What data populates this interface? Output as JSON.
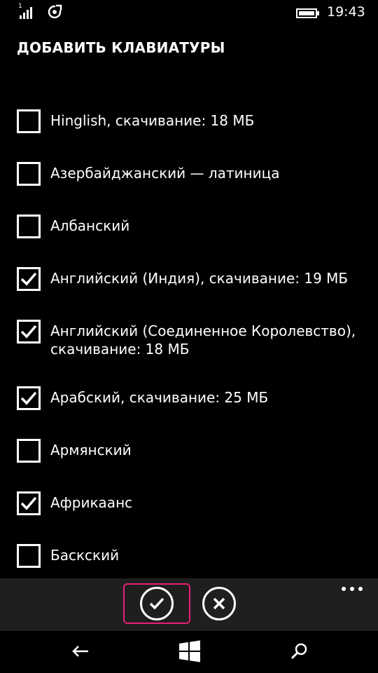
{
  "status": {
    "sim_label": "1",
    "time": "19:43"
  },
  "page": {
    "title": "ДОБАВИТЬ КЛАВИАТУРЫ"
  },
  "keyboards": [
    {
      "label": "Hinglish, скачивание: 18 МБ",
      "checked": false
    },
    {
      "label": "Азербайджанский — латиница",
      "checked": false
    },
    {
      "label": "Албанский",
      "checked": false
    },
    {
      "label": "Английский (Индия), скачивание: 19 МБ",
      "checked": true
    },
    {
      "label": "Английский (Соединенное Королевство), скачивание: 18 МБ",
      "checked": true
    },
    {
      "label": "Арабский, скачивание: 25 МБ",
      "checked": true
    },
    {
      "label": "Армянский",
      "checked": false
    },
    {
      "label": "Африкаанс",
      "checked": true
    },
    {
      "label": "Баскский",
      "checked": false
    }
  ],
  "appbar": {
    "accent_highlight": "#e8207a",
    "background": "#1f1f1f"
  },
  "icons": {
    "signal": "signal-strength-icon",
    "wifi": "wifi-icon",
    "battery": "battery-icon",
    "accept": "checkmark-icon",
    "cancel": "close-icon",
    "more": "more-options-icon",
    "back": "back-arrow-icon",
    "start": "windows-logo-icon",
    "search": "search-icon"
  }
}
